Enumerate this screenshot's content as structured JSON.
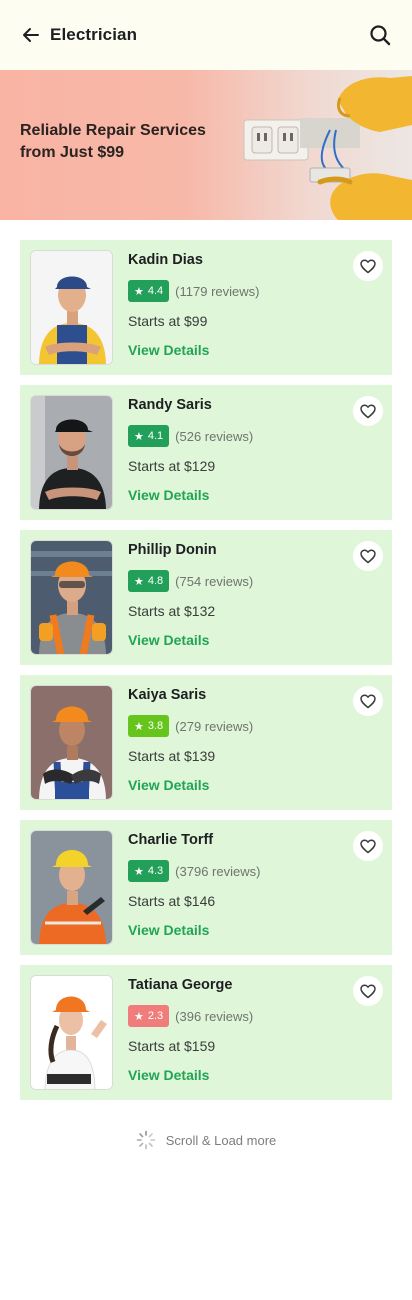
{
  "header": {
    "title": "Electrician"
  },
  "banner": {
    "headline": "Reliable Repair Services from Just $99"
  },
  "colors": {
    "card_bg": "#dff6d8",
    "accent_green": "#22a455",
    "rating_high": "#22a05a",
    "rating_mid": "#66c51c",
    "rating_low": "#f07c7c"
  },
  "providers": [
    {
      "name": "Kadin Dias",
      "rating": "4.4",
      "reviews": "(1179 reviews)",
      "price": "Starts at $99",
      "details_label": "View Details",
      "badge_color": "#22a05a"
    },
    {
      "name": "Randy Saris",
      "rating": "4.1",
      "reviews": "(526 reviews)",
      "price": "Starts at $129",
      "details_label": "View Details",
      "badge_color": "#22a05a"
    },
    {
      "name": "Phillip Donin",
      "rating": "4.8",
      "reviews": "(754 reviews)",
      "price": "Starts at $132",
      "details_label": "View Details",
      "badge_color": "#22a05a"
    },
    {
      "name": "Kaiya Saris",
      "rating": "3.8",
      "reviews": "(279 reviews)",
      "price": "Starts at $139",
      "details_label": "View Details",
      "badge_color": "#66c51c"
    },
    {
      "name": "Charlie Torff",
      "rating": "4.3",
      "reviews": "(3796 reviews)",
      "price": "Starts at $146",
      "details_label": "View Details",
      "badge_color": "#22a05a"
    },
    {
      "name": "Tatiana George",
      "rating": "2.3",
      "reviews": "(396 reviews)",
      "price": "Starts at $159",
      "details_label": "View Details",
      "badge_color": "#f07c7c"
    }
  ],
  "footer": {
    "load_more": "Scroll & Load more"
  }
}
